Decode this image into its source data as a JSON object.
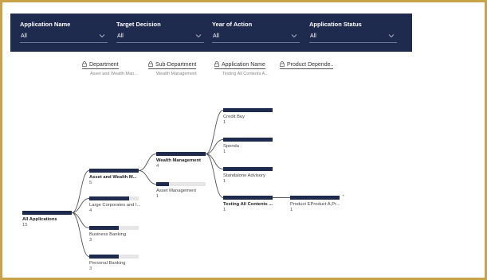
{
  "filters": [
    {
      "label": "Application Name",
      "value": "All"
    },
    {
      "label": "Target Decision",
      "value": "All"
    },
    {
      "label": "Year of Action",
      "value": "All"
    },
    {
      "label": "Application Status",
      "value": "All"
    }
  ],
  "columns": [
    {
      "title": "Department",
      "subtitle": "Asset and Wealth Man..."
    },
    {
      "title": "Sub-Department",
      "subtitle": "Wealth Management"
    },
    {
      "title": "Application Name",
      "subtitle": "Testing All Contents A..."
    },
    {
      "title": "Product Depende..",
      "subtitle": ""
    }
  ],
  "tree": {
    "root": {
      "label": "All Applications",
      "value": "15"
    },
    "level1": [
      {
        "label": "Asset and Wealth M...",
        "value": "5",
        "fill": 1.0,
        "selected": true
      },
      {
        "label": "Large Corporates and I...",
        "value": "4",
        "fill": 0.8,
        "selected": false
      },
      {
        "label": "Business Banking",
        "value": "3",
        "fill": 0.6,
        "selected": false
      },
      {
        "label": "Personal Banking",
        "value": "3",
        "fill": 0.6,
        "selected": false
      }
    ],
    "level2": [
      {
        "label": "Wealth Management",
        "value": "4",
        "fill": 1.0,
        "selected": true
      },
      {
        "label": "Asset Management",
        "value": "1",
        "fill": 0.25,
        "selected": false
      }
    ],
    "level3": [
      {
        "label": "Credit Buy",
        "value": "1",
        "fill": 1.0,
        "selected": false
      },
      {
        "label": "Spenda",
        "value": "1",
        "fill": 1.0,
        "selected": false
      },
      {
        "label": "Standalone Advisory",
        "value": "1",
        "fill": 1.0,
        "selected": false
      },
      {
        "label": "Testing All Contents ...",
        "value": "1",
        "fill": 1.0,
        "selected": true
      }
    ],
    "level4": [
      {
        "label": "Product EProduct A,Pr...",
        "value": "1",
        "fill": 1.0,
        "selected": false
      }
    ]
  },
  "colors": {
    "bar": "#1f2a4f",
    "track": "#e6e6e6",
    "border": "#c9a24a"
  }
}
